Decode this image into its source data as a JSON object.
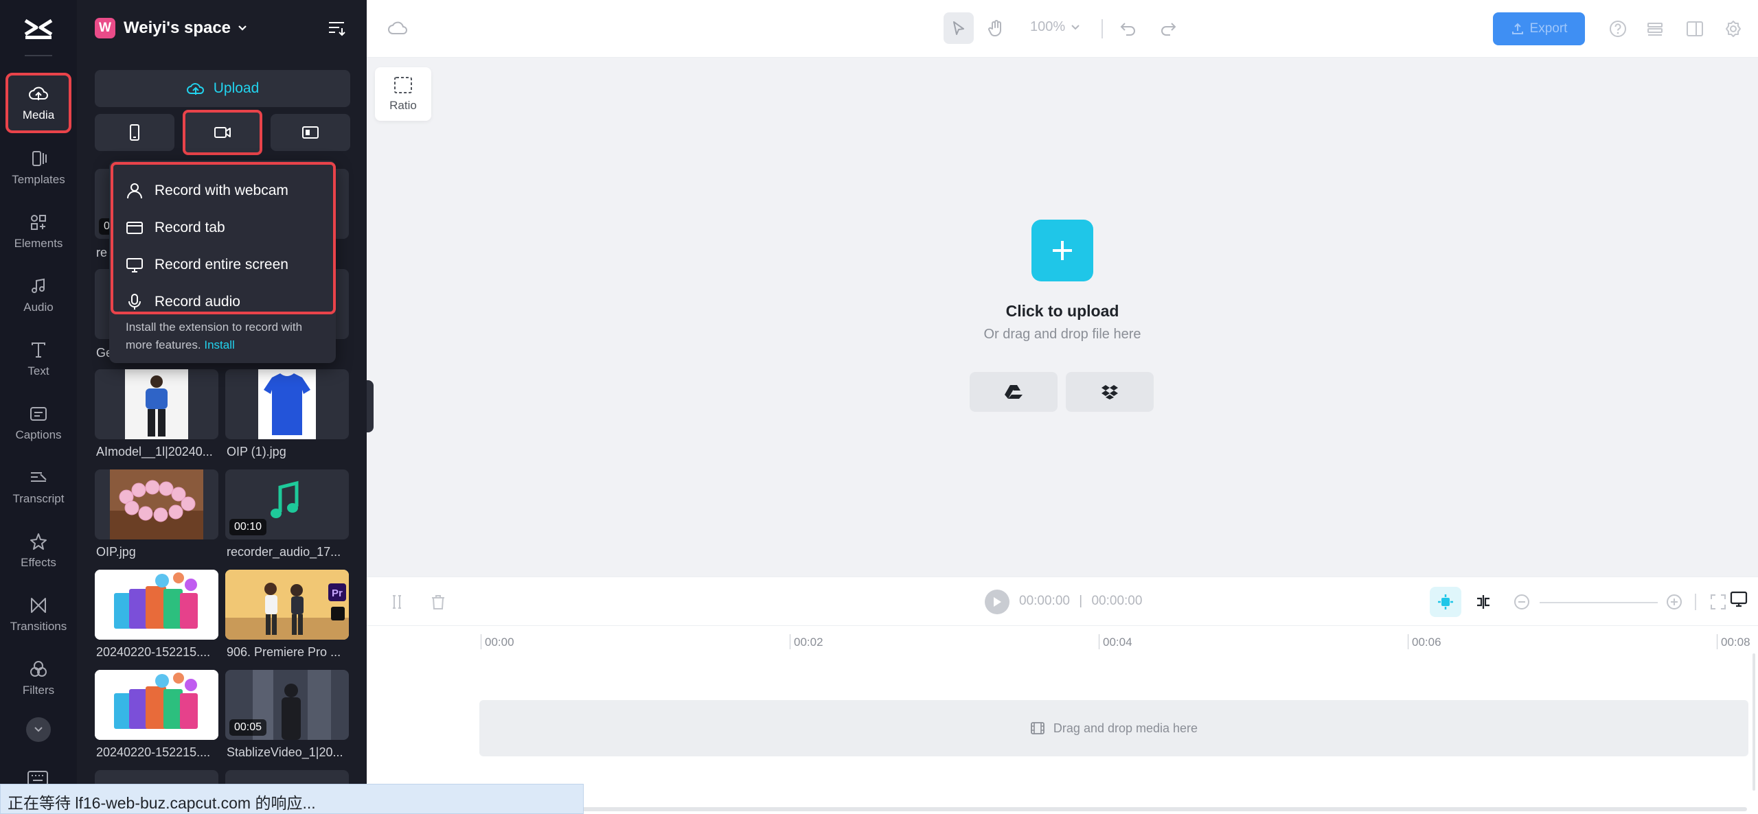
{
  "rail": {
    "items": [
      {
        "label": "Media",
        "icon": "cloud-upload-icon",
        "active": true
      },
      {
        "label": "Templates",
        "icon": "templates-icon"
      },
      {
        "label": "Elements",
        "icon": "elements-icon"
      },
      {
        "label": "Audio",
        "icon": "music-note-icon"
      },
      {
        "label": "Text",
        "icon": "text-icon"
      },
      {
        "label": "Captions",
        "icon": "captions-icon"
      },
      {
        "label": "Transcript",
        "icon": "transcript-icon"
      },
      {
        "label": "Effects",
        "icon": "effects-icon"
      },
      {
        "label": "Transitions",
        "icon": "transitions-icon"
      },
      {
        "label": "Filters",
        "icon": "filters-icon"
      }
    ]
  },
  "panel": {
    "space_initial": "W",
    "space_name": "Weiyi's space",
    "upload_label": "Upload",
    "dropdown": {
      "items": [
        {
          "label": "Record with webcam",
          "icon": "user-icon"
        },
        {
          "label": "Record tab",
          "icon": "browser-tab-icon"
        },
        {
          "label": "Record entire screen",
          "icon": "monitor-icon"
        },
        {
          "label": "Record audio",
          "icon": "microphone-icon"
        }
      ],
      "note": "Install the extension to record with more features.",
      "note_link": "Install"
    },
    "partial_captions": [
      "re",
      "Ge"
    ],
    "partial_duration": "0",
    "media": [
      {
        "name": "AImodel__1l|20240...",
        "duration": ""
      },
      {
        "name": "OIP (1).jpg",
        "duration": ""
      },
      {
        "name": "OIP.jpg",
        "duration": ""
      },
      {
        "name": "recorder_audio_17...",
        "duration": "00:10"
      },
      {
        "name": "20240220-152215....",
        "duration": ""
      },
      {
        "name": "906. Premiere Pro ...",
        "duration": ""
      },
      {
        "name": "20240220-152215....",
        "duration": ""
      },
      {
        "name": "StablizeVideo_1|20...",
        "duration": "00:05"
      }
    ]
  },
  "topbar": {
    "zoom": "100%",
    "export_label": "Export"
  },
  "canvas": {
    "ratio_label": "Ratio",
    "upload_title": "Click to upload",
    "upload_sub": "Or drag and drop file here"
  },
  "timeline": {
    "current_time": "00:00:00",
    "total_time": "00:00:00",
    "ticks": [
      "00:00",
      "00:02",
      "00:04",
      "00:06",
      "00:08"
    ],
    "drop_text": "Drag and drop media here"
  },
  "status_text": "正在等待 lf16-web-buz.capcut.com 的响应...",
  "colors": {
    "accent": "#22d3ee",
    "highlight": "#e9434a",
    "export": "#3f8ff3",
    "rail_bg": "#161823"
  }
}
